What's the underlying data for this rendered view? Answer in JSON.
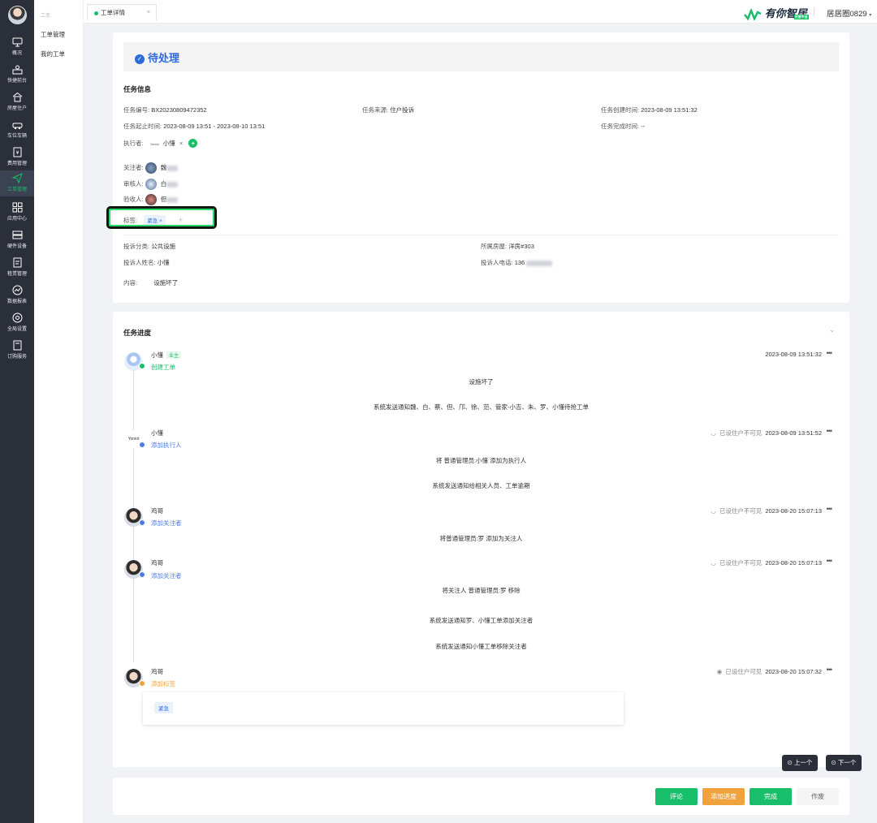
{
  "sidebar": {
    "items": [
      {
        "label": "概况",
        "icon": "monitor-icon"
      },
      {
        "label": "快捷前台",
        "icon": "desk-icon"
      },
      {
        "label": "房屋住户",
        "icon": "house-icon"
      },
      {
        "label": "车位车辆",
        "icon": "car-icon"
      },
      {
        "label": "费用管理",
        "icon": "fee-icon"
      },
      {
        "label": "工单管理",
        "icon": "send-icon"
      },
      {
        "label": "应用中心",
        "icon": "apps-icon"
      },
      {
        "label": "硬件设备",
        "icon": "device-icon"
      },
      {
        "label": "租赁管理",
        "icon": "lease-icon"
      },
      {
        "label": "数据报表",
        "icon": "report-icon"
      },
      {
        "label": "全局设置",
        "icon": "settings-icon"
      },
      {
        "label": "订购服务",
        "icon": "order-icon"
      }
    ]
  },
  "subnav": {
    "group": "工单",
    "items": [
      "工单管理",
      "我的工单"
    ]
  },
  "tabs": [
    {
      "label": "工单详情",
      "close": "×"
    }
  ],
  "brand": {
    "name": "有你智居",
    "badge": "开放平台"
  },
  "user": {
    "name": "居居圈0829"
  },
  "status": {
    "text": "待处理"
  },
  "task_info": {
    "title": "任务信息",
    "id_label": "任务编号:",
    "id": "BX20230809472352",
    "source_label": "任务来源:",
    "source": "住户投诉",
    "created_label": "任务创建时间:",
    "created": "2023-08-09 13:51:32",
    "period_label": "任务起止时间:",
    "period": "2023-08-09 13:51 - 2023-08-10 13:51",
    "finished_label": "任务完成时间:",
    "finished": "--",
    "executor_label": "执行者:",
    "executor_logo": "Yoniot",
    "executor": "小懂",
    "follower_label": "关注者:",
    "follower": "魏",
    "reviewer_label": "审核人:",
    "reviewer": "白",
    "acceptor_label": "验收人:",
    "acceptor": "但",
    "tags_label": "标签:",
    "tag": "紧急",
    "tag_add": "+",
    "category_label": "投诉分类:",
    "category": "公共设施",
    "room_label": "所属房屋:",
    "room": "洋房#303",
    "complainant_label": "投诉人姓名:",
    "complainant": "小懂",
    "phone_label": "投诉人电话:",
    "phone": "136",
    "content_label": "内容:",
    "content": "设施坏了"
  },
  "progress": {
    "title": "任务进度",
    "events": [
      {
        "name": "小懂",
        "badge": "业主",
        "action": "创建工单",
        "time": "2023-08-09 13:51:32",
        "vis": "",
        "msgs": [
          "设施坏了",
          "系统发送通知魏、白、蔡、但、邝、徐、范、管家-小吉、朱、罗、小懂待抢工单"
        ]
      },
      {
        "name": "小懂",
        "logo": "Yoniot",
        "action": "添加执行人",
        "time": "2023-08-09 13:51:52",
        "vis": "已设住户不可见",
        "msgs": [
          "将 普通管理员:小懂 添加为执行人",
          "系统发送通知给相关人员、工单逾期"
        ]
      },
      {
        "name": "鸡哥",
        "action": "添加关注者",
        "time": "2023-08-20 15:07:13",
        "vis": "已设住户不可见",
        "msgs": [
          "将普通管理员:罗 添加为关注人"
        ]
      },
      {
        "name": "鸡哥",
        "action": "添加关注者",
        "time": "2023-08-20 15:07:13",
        "vis": "已设住户不可见",
        "msgs": [
          "将关注人 普通管理员:罗 移除",
          "系统发送通知罗、小懂工单添加关注者",
          "系统发送通知小懂工单移除关注者"
        ]
      },
      {
        "name": "鸡哥",
        "action": "添加标签",
        "time": "2023-08-20 15:07:32",
        "vis": "已设住户可见",
        "msgs": [
          "紧急"
        ]
      }
    ]
  },
  "pager": {
    "prev": "上一个",
    "next": "下一个"
  },
  "actions": {
    "comment": "评论",
    "add_progress": "添加进度",
    "complete": "完成",
    "void": "作废"
  },
  "colors": {
    "green": "#19be6b",
    "blue": "#2d6ad8",
    "orange": "#f0a23c",
    "sidebar": "#2b2f3a"
  }
}
